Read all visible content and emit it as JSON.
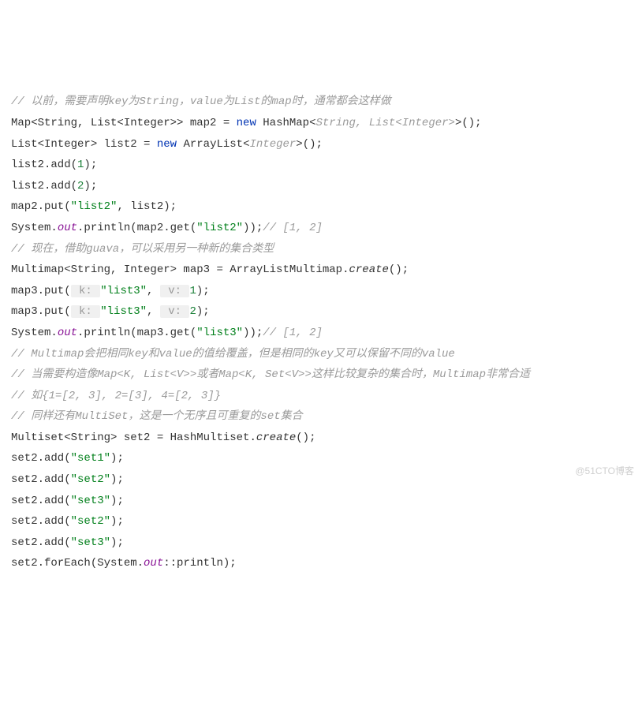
{
  "lines": {
    "c1": "// 以前，需要声明key为String，value为List的map时，通常都会这样做",
    "l2_a": "Map<String, List<Integer>> map2 = ",
    "l2_new": "new",
    "l2_b": " HashMap<",
    "l2_gen": "String, List<Integer>",
    "l2_c": ">();",
    "l3_a": "List<Integer> list2 = ",
    "l3_new": "new",
    "l3_b": " ArrayList<",
    "l3_gen": "Integer",
    "l3_c": ">();",
    "l4_a": "list2.add(",
    "l4_n": "1",
    "l4_b": ");",
    "l5_a": "list2.add(",
    "l5_n": "2",
    "l5_b": ");",
    "l6_a": "map2.put(",
    "l6_s": "\"list2\"",
    "l6_b": ", list2);",
    "l7_a": "System.",
    "l7_out": "out",
    "l7_b": ".println(map2.get(",
    "l7_s": "\"list2\"",
    "l7_c": "));",
    "l7_cm": "// [1, 2]",
    "c8": "// 现在，借助guava，可以采用另一种新的集合类型",
    "l9_a": "Multimap<String, Integer> map3 = ArrayListMultimap.",
    "l9_m": "create",
    "l9_b": "();",
    "l10_a": "map3.put(",
    "l10_h1": " k: ",
    "l10_s": "\"list3\"",
    "l10_b": ", ",
    "l10_h2": " v: ",
    "l10_n": "1",
    "l10_c": ");",
    "l11_a": "map3.put(",
    "l11_h1": " k: ",
    "l11_s": "\"list3\"",
    "l11_b": ", ",
    "l11_h2": " v: ",
    "l11_n": "2",
    "l11_c": ");",
    "l12_a": "System.",
    "l12_out": "out",
    "l12_b": ".println(map3.get(",
    "l12_s": "\"list3\"",
    "l12_c": "));",
    "l12_cm": "// [1, 2]",
    "c13": "// Multimap会把相同key和value的值给覆盖，但是相同的key又可以保留不同的value",
    "c14": "// 当需要构造像Map<K, List<V>>或者Map<K, Set<V>>这样比较复杂的集合时，Multimap非常合适",
    "c15": "// 如{1=[2, 3], 2=[3], 4=[2, 3]}",
    "c16": "// 同样还有MultiSet，这是一个无序且可重复的set集合",
    "l17_a": "Multiset<String> set2 = HashMultiset.",
    "l17_m": "create",
    "l17_b": "();",
    "l18_a": "set2.add(",
    "l18_s": "\"set1\"",
    "l18_b": ");",
    "l19_a": "set2.add(",
    "l19_s": "\"set2\"",
    "l19_b": ");",
    "l20_a": "set2.add(",
    "l20_s": "\"set3\"",
    "l20_b": ");",
    "l21_a": "set2.add(",
    "l21_s": "\"set2\"",
    "l21_b": ");",
    "l22_a": "set2.add(",
    "l22_s": "\"set3\"",
    "l22_b": ");",
    "l23_a": "set2.forEach(System.",
    "l23_out": "out",
    "l23_b": "::println);"
  },
  "watermark": "@51CTO博客"
}
